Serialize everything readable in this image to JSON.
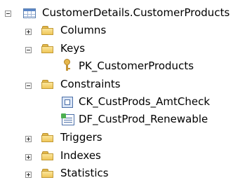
{
  "tree": {
    "root": {
      "label": "CustomerDetails.CustomerProducts",
      "expanded": true,
      "icon": "table-icon"
    },
    "columns": {
      "label": "Columns",
      "expanded": false
    },
    "keys": {
      "label": "Keys",
      "expanded": true,
      "items": [
        {
          "label": "PK_CustomerProducts",
          "icon": "key-icon"
        }
      ]
    },
    "constraints": {
      "label": "Constraints",
      "expanded": true,
      "items": [
        {
          "label": "CK_CustProds_AmtCheck",
          "icon": "check-constraint-icon"
        },
        {
          "label": "DF_CustProd_Renewable",
          "icon": "default-constraint-icon"
        }
      ]
    },
    "triggers": {
      "label": "Triggers",
      "expanded": false
    },
    "indexes": {
      "label": "Indexes",
      "expanded": false
    },
    "statistics": {
      "label": "Statistics",
      "expanded": false
    }
  }
}
